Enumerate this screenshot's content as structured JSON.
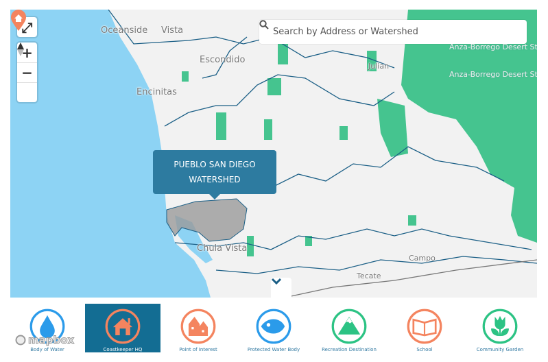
{
  "map": {
    "labels": {
      "oceanside": "Oceanside",
      "vista": "Vista",
      "escondido": "Escondido",
      "encinitas": "Encinitas",
      "julian": "Julian",
      "abdsp": "Anza-Borrego Desert State Park",
      "abdsw": "Anza-Borrego Desert State Wilderness",
      "chula_vista": "Chula Vista",
      "campo": "Campo",
      "tecate": "Tecate"
    },
    "colors": {
      "ocean": "#8dd3f4",
      "land": "#f2f2f2",
      "parks": "#45c48f",
      "boundary": "#1b5f86",
      "selected_watershed": "#9a9a9a"
    },
    "controls": {
      "fullscreen": "expand-icon",
      "zoom_in": "+",
      "zoom_out": "−",
      "compass": "compass-icon"
    },
    "search": {
      "placeholder": "Search by Address or Watershed"
    },
    "popup": {
      "title": "PUEBLO SAN DIEGO WATERSHED"
    },
    "attribution": "mapbox"
  },
  "legend": {
    "selected": "Coastkeeper HQ",
    "items": [
      {
        "label": "Body of Water",
        "icon": "water-drop-icon",
        "color": "#2b9bea"
      },
      {
        "label": "Coastkeeper HQ",
        "icon": "house-icon",
        "color": "#f4845f"
      },
      {
        "label": "Point of Interest",
        "icon": "buildings-icon",
        "color": "#f4845f"
      },
      {
        "label": "Protected Water Body",
        "icon": "fish-icon",
        "color": "#2b9bea"
      },
      {
        "label": "Recreation Destination",
        "icon": "mountain-icon",
        "color": "#2cc384"
      },
      {
        "label": "School",
        "icon": "book-icon",
        "color": "#f4845f"
      },
      {
        "label": "Community Garden",
        "icon": "tulip-icon",
        "color": "#2cc384"
      }
    ]
  }
}
